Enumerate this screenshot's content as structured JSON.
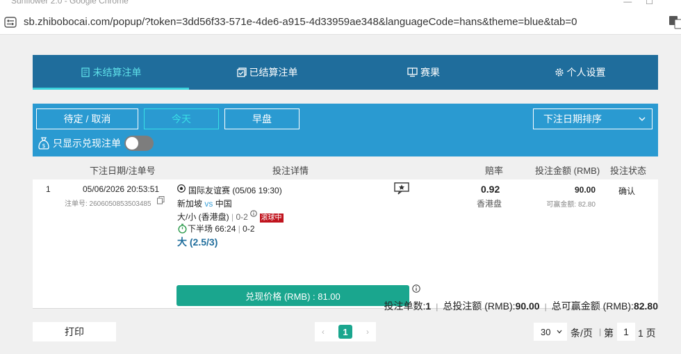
{
  "browser": {
    "window_title": "Sunflower 2.0 - Google Chrome",
    "url": "sb.zhibobocai.com/popup/?token=3dd56f33-571e-4de6-a915-4d33959ae348&languageCode=hans&theme=blue&tab=0"
  },
  "tabs": [
    {
      "label": "未结算注单",
      "icon": "bet-slip-icon",
      "active": true
    },
    {
      "label": "已结算注单",
      "icon": "settled-icon",
      "active": false
    },
    {
      "label": "赛果",
      "icon": "scoreboard-icon",
      "active": false
    },
    {
      "label": "个人设置",
      "icon": "gear-icon",
      "active": false
    }
  ],
  "filters": {
    "buttons": [
      {
        "label": "待定 / 取消",
        "active": false
      },
      {
        "label": "今天",
        "active": true
      },
      {
        "label": "早盘",
        "active": false
      }
    ],
    "sort_label": "下注日期排序",
    "cash_only_label": "只显示兑现注单",
    "cash_only_on": false
  },
  "columns": {
    "date": "下注日期/注单号",
    "details": "投注详情",
    "odds": "赔率",
    "stake": "投注金额 (RMB)",
    "status": "投注状态"
  },
  "bet": {
    "index": "1",
    "datetime": "05/06/2026 20:53:51",
    "ticket": "注单号: 2606050853503485",
    "league": "国际友谊赛 (05/06 19:30)",
    "home": "新加坡",
    "vs": "vs",
    "away": "中国",
    "market": "大/小 (香港盘)",
    "market_score": "0-2",
    "live_badge": "滚球中",
    "period": "下半场 66:24",
    "period_score": "0-2",
    "selection": "大 (2.5/3)",
    "cashout": "兑现价格 (RMB) : 81.00",
    "odds": "0.92",
    "odds_type": "香港盘",
    "stake": "90.00",
    "win": "可赢金额: 82.80",
    "status": "确认"
  },
  "summary": {
    "count_label": "投注单数:",
    "count": "1",
    "total_label": "总投注额 (RMB):",
    "total": "90.00",
    "win_label": "总可赢金额 (RMB):",
    "win": "82.80"
  },
  "footer": {
    "print": "打印",
    "prev": "‹",
    "page": "1",
    "next": "›",
    "page_size": "30",
    "per_page": "条/页",
    "page_label": "第",
    "page_input": "1",
    "page_suffix": "1 页"
  },
  "colors": {
    "tab_bar": "#1f6d9c",
    "filter_bar": "#2a9ad1",
    "active_tab": "#5fe0e9",
    "accent_green": "#1aa68e",
    "selection_text": "#1f6d9c",
    "live_badge": "#c0141e"
  }
}
